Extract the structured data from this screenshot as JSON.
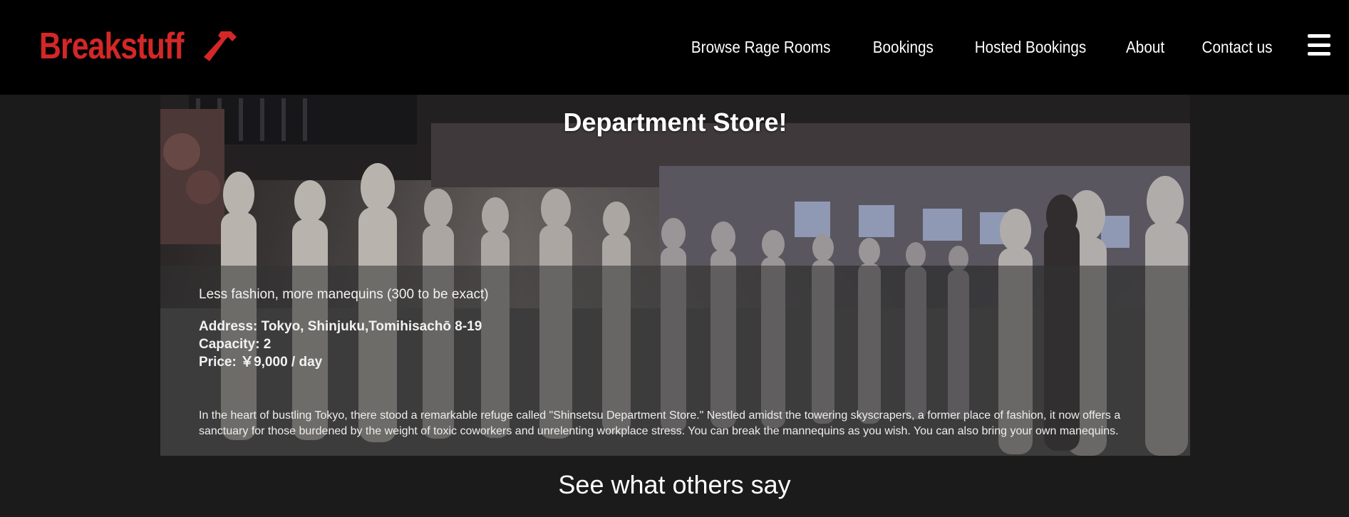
{
  "brand": {
    "name": "Breakstuff",
    "icon": "hammer-icon",
    "color": "#d42727"
  },
  "nav": {
    "links": [
      {
        "label": "Browse Rage Rooms"
      },
      {
        "label": "Bookings"
      },
      {
        "label": "Hosted Bookings"
      },
      {
        "label": "About"
      },
      {
        "label": "Contact us"
      }
    ],
    "menu_icon": "hamburger-menu-icon"
  },
  "room": {
    "title": "Department Store!",
    "tagline": "Less fashion, more manequins (300 to be exact)",
    "address": "Address: Tokyo, Shinjuku,Tomihisachō 8-19",
    "capacity": "Capacity: 2",
    "price": "Price:  ￥9,000 / day",
    "description": "In the heart of bustling Tokyo, there stood a remarkable refuge called \"Shinsetsu Department Store.\" Nestled amidst the towering skyscrapers, a former place of fashion, it now offers a sanctuary for those burdened by the weight of toxic coworkers and unrelenting workplace stress. You can break the mannequins as you wish. You can also bring your own manequins."
  },
  "reviews": {
    "heading": "See what others say"
  }
}
